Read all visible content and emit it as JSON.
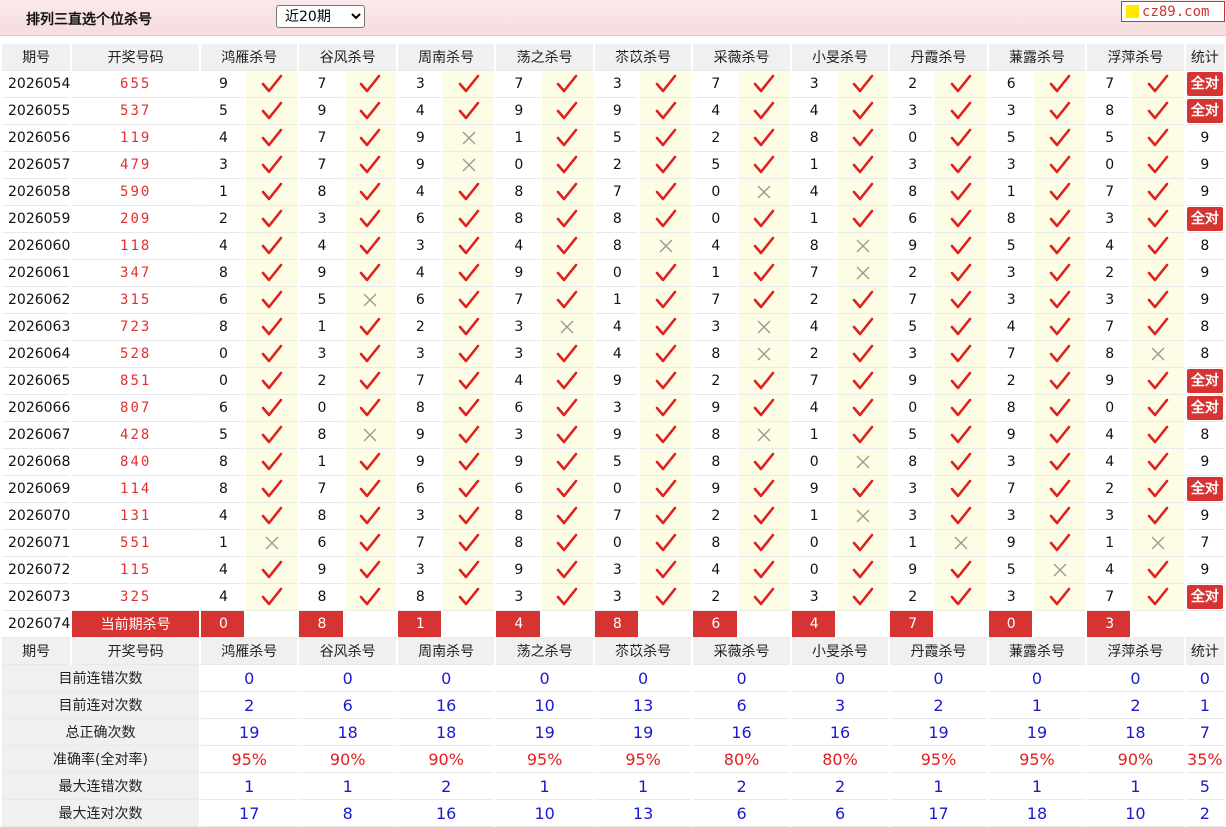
{
  "header": {
    "title": "排列三直选个位杀号",
    "period_select": "近20期",
    "brand": "cz89.com"
  },
  "table": {
    "col_issue": "期号",
    "col_draw": "开奖号码",
    "col_stat": "统计",
    "experts": [
      "鸿雁杀号",
      "谷风杀号",
      "周南杀号",
      "荡之杀号",
      "苶苡杀号",
      "采薇杀号",
      "小旻杀号",
      "丹霞杀号",
      "蒹露杀号",
      "浮萍杀号"
    ],
    "all_right_label": "全对",
    "rows": [
      {
        "issue": "2026054",
        "draw": "655",
        "kills": [
          9,
          7,
          3,
          7,
          3,
          7,
          3,
          2,
          6,
          7
        ],
        "hits": [
          1,
          1,
          1,
          1,
          1,
          1,
          1,
          1,
          1,
          1
        ],
        "stat": "全对"
      },
      {
        "issue": "2026055",
        "draw": "537",
        "kills": [
          5,
          9,
          4,
          9,
          9,
          4,
          4,
          3,
          3,
          8
        ],
        "hits": [
          1,
          1,
          1,
          1,
          1,
          1,
          1,
          1,
          1,
          1
        ],
        "stat": "全对"
      },
      {
        "issue": "2026056",
        "draw": "119",
        "kills": [
          4,
          7,
          9,
          1,
          5,
          2,
          8,
          0,
          5,
          5
        ],
        "hits": [
          1,
          1,
          0,
          1,
          1,
          1,
          1,
          1,
          1,
          1
        ],
        "stat": "9"
      },
      {
        "issue": "2026057",
        "draw": "479",
        "kills": [
          3,
          7,
          9,
          0,
          2,
          5,
          1,
          3,
          3,
          0
        ],
        "hits": [
          1,
          1,
          0,
          1,
          1,
          1,
          1,
          1,
          1,
          1
        ],
        "stat": "9"
      },
      {
        "issue": "2026058",
        "draw": "590",
        "kills": [
          1,
          8,
          4,
          8,
          7,
          0,
          4,
          8,
          1,
          7
        ],
        "hits": [
          1,
          1,
          1,
          1,
          1,
          0,
          1,
          1,
          1,
          1
        ],
        "stat": "9"
      },
      {
        "issue": "2026059",
        "draw": "209",
        "kills": [
          2,
          3,
          6,
          8,
          8,
          0,
          1,
          6,
          8,
          3
        ],
        "hits": [
          1,
          1,
          1,
          1,
          1,
          1,
          1,
          1,
          1,
          1
        ],
        "stat": "全对"
      },
      {
        "issue": "2026060",
        "draw": "118",
        "kills": [
          4,
          4,
          3,
          4,
          8,
          4,
          8,
          9,
          5,
          4
        ],
        "hits": [
          1,
          1,
          1,
          1,
          0,
          1,
          0,
          1,
          1,
          1
        ],
        "stat": "8"
      },
      {
        "issue": "2026061",
        "draw": "347",
        "kills": [
          8,
          9,
          4,
          9,
          0,
          1,
          7,
          2,
          3,
          2
        ],
        "hits": [
          1,
          1,
          1,
          1,
          1,
          1,
          0,
          1,
          1,
          1
        ],
        "stat": "9"
      },
      {
        "issue": "2026062",
        "draw": "315",
        "kills": [
          6,
          5,
          6,
          7,
          1,
          7,
          2,
          7,
          3,
          3
        ],
        "hits": [
          1,
          0,
          1,
          1,
          1,
          1,
          1,
          1,
          1,
          1
        ],
        "stat": "9"
      },
      {
        "issue": "2026063",
        "draw": "723",
        "kills": [
          8,
          1,
          2,
          3,
          4,
          3,
          4,
          5,
          4,
          7
        ],
        "hits": [
          1,
          1,
          1,
          0,
          1,
          0,
          1,
          1,
          1,
          1
        ],
        "stat": "8"
      },
      {
        "issue": "2026064",
        "draw": "528",
        "kills": [
          0,
          3,
          3,
          3,
          4,
          8,
          2,
          3,
          7,
          8
        ],
        "hits": [
          1,
          1,
          1,
          1,
          1,
          0,
          1,
          1,
          1,
          0
        ],
        "stat": "8"
      },
      {
        "issue": "2026065",
        "draw": "851",
        "kills": [
          0,
          2,
          7,
          4,
          9,
          2,
          7,
          9,
          2,
          9
        ],
        "hits": [
          1,
          1,
          1,
          1,
          1,
          1,
          1,
          1,
          1,
          1
        ],
        "stat": "全对"
      },
      {
        "issue": "2026066",
        "draw": "807",
        "kills": [
          6,
          0,
          8,
          6,
          3,
          9,
          4,
          0,
          8,
          0
        ],
        "hits": [
          1,
          1,
          1,
          1,
          1,
          1,
          1,
          1,
          1,
          1
        ],
        "stat": "全对"
      },
      {
        "issue": "2026067",
        "draw": "428",
        "kills": [
          5,
          8,
          9,
          3,
          9,
          8,
          1,
          5,
          9,
          4
        ],
        "hits": [
          1,
          0,
          1,
          1,
          1,
          0,
          1,
          1,
          1,
          1
        ],
        "stat": "8"
      },
      {
        "issue": "2026068",
        "draw": "840",
        "kills": [
          8,
          1,
          9,
          9,
          5,
          8,
          0,
          8,
          3,
          4
        ],
        "hits": [
          1,
          1,
          1,
          1,
          1,
          1,
          0,
          1,
          1,
          1
        ],
        "stat": "9"
      },
      {
        "issue": "2026069",
        "draw": "114",
        "kills": [
          8,
          7,
          6,
          6,
          0,
          9,
          9,
          3,
          7,
          2
        ],
        "hits": [
          1,
          1,
          1,
          1,
          1,
          1,
          1,
          1,
          1,
          1
        ],
        "stat": "全对"
      },
      {
        "issue": "2026070",
        "draw": "131",
        "kills": [
          4,
          8,
          3,
          8,
          7,
          2,
          1,
          3,
          3,
          3
        ],
        "hits": [
          1,
          1,
          1,
          1,
          1,
          1,
          0,
          1,
          1,
          1
        ],
        "stat": "9"
      },
      {
        "issue": "2026071",
        "draw": "551",
        "kills": [
          1,
          6,
          7,
          8,
          0,
          8,
          0,
          1,
          9,
          1
        ],
        "hits": [
          0,
          1,
          1,
          1,
          1,
          1,
          1,
          0,
          1,
          0
        ],
        "stat": "7"
      },
      {
        "issue": "2026072",
        "draw": "115",
        "kills": [
          4,
          9,
          3,
          9,
          3,
          4,
          0,
          9,
          5,
          4
        ],
        "hits": [
          1,
          1,
          1,
          1,
          1,
          1,
          1,
          1,
          0,
          1
        ],
        "stat": "9"
      },
      {
        "issue": "2026073",
        "draw": "325",
        "kills": [
          4,
          8,
          8,
          3,
          3,
          2,
          3,
          2,
          3,
          7
        ],
        "hits": [
          1,
          1,
          1,
          1,
          1,
          1,
          1,
          1,
          1,
          1
        ],
        "stat": "全对"
      }
    ],
    "current": {
      "issue": "2026074",
      "label": "当前期杀号",
      "kills": [
        "0",
        "8",
        "1",
        "4",
        "8",
        "6",
        "4",
        "7",
        "0",
        "3"
      ]
    }
  },
  "summary": {
    "rows": [
      {
        "label": "目前连错次数",
        "values": [
          "0",
          "0",
          "0",
          "0",
          "0",
          "0",
          "0",
          "0",
          "0",
          "0"
        ],
        "stat": "0",
        "style": "val"
      },
      {
        "label": "目前连对次数",
        "values": [
          "2",
          "6",
          "16",
          "10",
          "13",
          "6",
          "3",
          "2",
          "1",
          "2"
        ],
        "stat": "1",
        "style": "val"
      },
      {
        "label": "总正确次数",
        "values": [
          "19",
          "18",
          "18",
          "19",
          "19",
          "16",
          "16",
          "19",
          "19",
          "18"
        ],
        "stat": "7",
        "style": "val"
      },
      {
        "label": "准确率(全对率)",
        "values": [
          "95%",
          "90%",
          "90%",
          "95%",
          "95%",
          "80%",
          "80%",
          "95%",
          "95%",
          "90%"
        ],
        "stat": "35%",
        "style": "pct"
      },
      {
        "label": "最大连错次数",
        "values": [
          "1",
          "1",
          "2",
          "1",
          "1",
          "2",
          "2",
          "1",
          "1",
          "1"
        ],
        "stat": "5",
        "style": "val"
      },
      {
        "label": "最大连对次数",
        "values": [
          "17",
          "8",
          "16",
          "10",
          "13",
          "6",
          "6",
          "17",
          "18",
          "10"
        ],
        "stat": "2",
        "style": "val"
      }
    ]
  },
  "icons": {
    "hit": "check-icon",
    "miss": "cross-icon"
  },
  "colors": {
    "accent": "#d63333",
    "check": "#e02020",
    "value_blue": "#1a1ad0",
    "mark_bg": "#fdfde6"
  }
}
